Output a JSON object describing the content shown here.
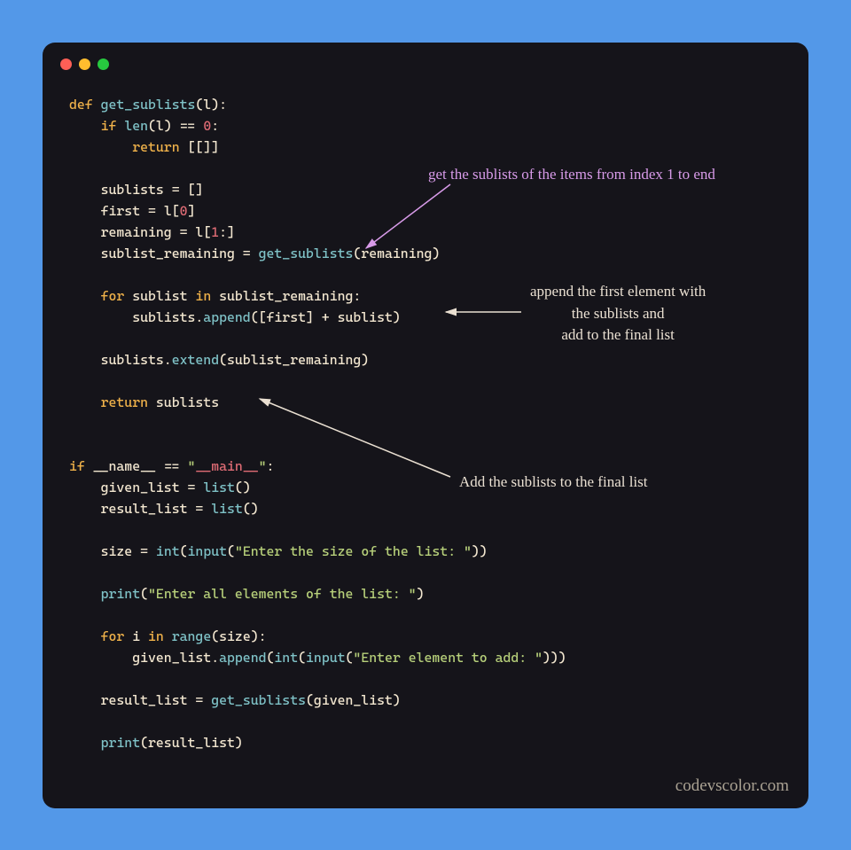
{
  "colors": {
    "page_bg": "#5398e8",
    "editor_bg": "#15141a",
    "keyword": "#f0b24a",
    "function": "#7fc2c7",
    "identifier": "#f3e7d0",
    "number": "#e06c75",
    "string": "#b7d07a",
    "annotation_default": "#eae0d2",
    "annotation_purple": "#d89be9",
    "dot_red": "#ff5f56",
    "dot_yellow": "#ffbd2e",
    "dot_green": "#27c93f"
  },
  "code": {
    "l1": {
      "def": "def ",
      "fn": "get_sublists",
      "open": "(l):"
    },
    "l2": {
      "kw": "if ",
      "call": "len",
      "rest1": "(l) ",
      "eq": "==",
      "rest2": " ",
      "zero": "0",
      "colon": ":"
    },
    "l3": {
      "kw": "return ",
      "val": "[[]]"
    },
    "l5": {
      "lhs": "sublists ",
      "eq": "=",
      "rhs": " []"
    },
    "l6": {
      "lhs": "first ",
      "eq": "=",
      "rhs1": " l[",
      "idx": "0",
      "rhs2": "]"
    },
    "l7": {
      "lhs": "remaining ",
      "eq": "=",
      "rhs1": " l[",
      "idx": "1",
      "rhs2": ":]"
    },
    "l8": {
      "lhs": "sublist_remaining ",
      "eq": "=",
      "sp": " ",
      "fn": "get_sublists",
      "args": "(remaining)"
    },
    "l10": {
      "kw1": "for ",
      "var": "sublist",
      "kw2": " in ",
      "iter": "sublist_remaining",
      "colon": ":"
    },
    "l11": {
      "obj": "sublists.",
      "meth": "append",
      "args": "([first] + sublist)"
    },
    "l13": {
      "obj": "sublists.",
      "meth": "extend",
      "args": "(sublist_remaining)"
    },
    "l15": {
      "kw": "return ",
      "val": "sublists"
    },
    "l18": {
      "kw": "if ",
      "name": "__name__",
      "sp": " ",
      "eq": "==",
      "sp2": " ",
      "q1": "\"",
      "main": "__main__",
      "q2": "\"",
      "colon": ":"
    },
    "l19": {
      "lhs": "given_list ",
      "eq": "=",
      "sp": " ",
      "fn": "list",
      "args": "()"
    },
    "l20": {
      "lhs": "result_list ",
      "eq": "=",
      "sp": " ",
      "fn": "list",
      "args": "()"
    },
    "l22": {
      "lhs": "size ",
      "eq": "=",
      "sp": " ",
      "fn1": "int",
      "open1": "(",
      "fn2": "input",
      "open2": "(",
      "str": "\"Enter the size of the list: \"",
      "close": "))"
    },
    "l24": {
      "fn": "print",
      "open": "(",
      "str": "\"Enter all elements of the list: \"",
      "close": ")"
    },
    "l26": {
      "kw1": "for ",
      "var": "i",
      "kw2": " in ",
      "fn": "range",
      "args": "(size):"
    },
    "l27": {
      "obj": "given_list.",
      "meth": "append",
      "open1": "(",
      "fn1": "int",
      "open2": "(",
      "fn2": "input",
      "open3": "(",
      "str": "\"Enter element to add: \"",
      "close": ")))"
    },
    "l29": {
      "lhs": "result_list ",
      "eq": "=",
      "sp": " ",
      "fn": "get_sublists",
      "args": "(given_list)"
    },
    "l31": {
      "fn": "print",
      "args": "(result_list)"
    }
  },
  "annotations": {
    "a1": "get the sublists of the items from index 1 to end",
    "a2_line1": "append the first element with",
    "a2_line2": "the sublists and",
    "a2_line3": "add to the final list",
    "a3": "Add the sublists to the final list"
  },
  "watermark": "codevscolor.com"
}
